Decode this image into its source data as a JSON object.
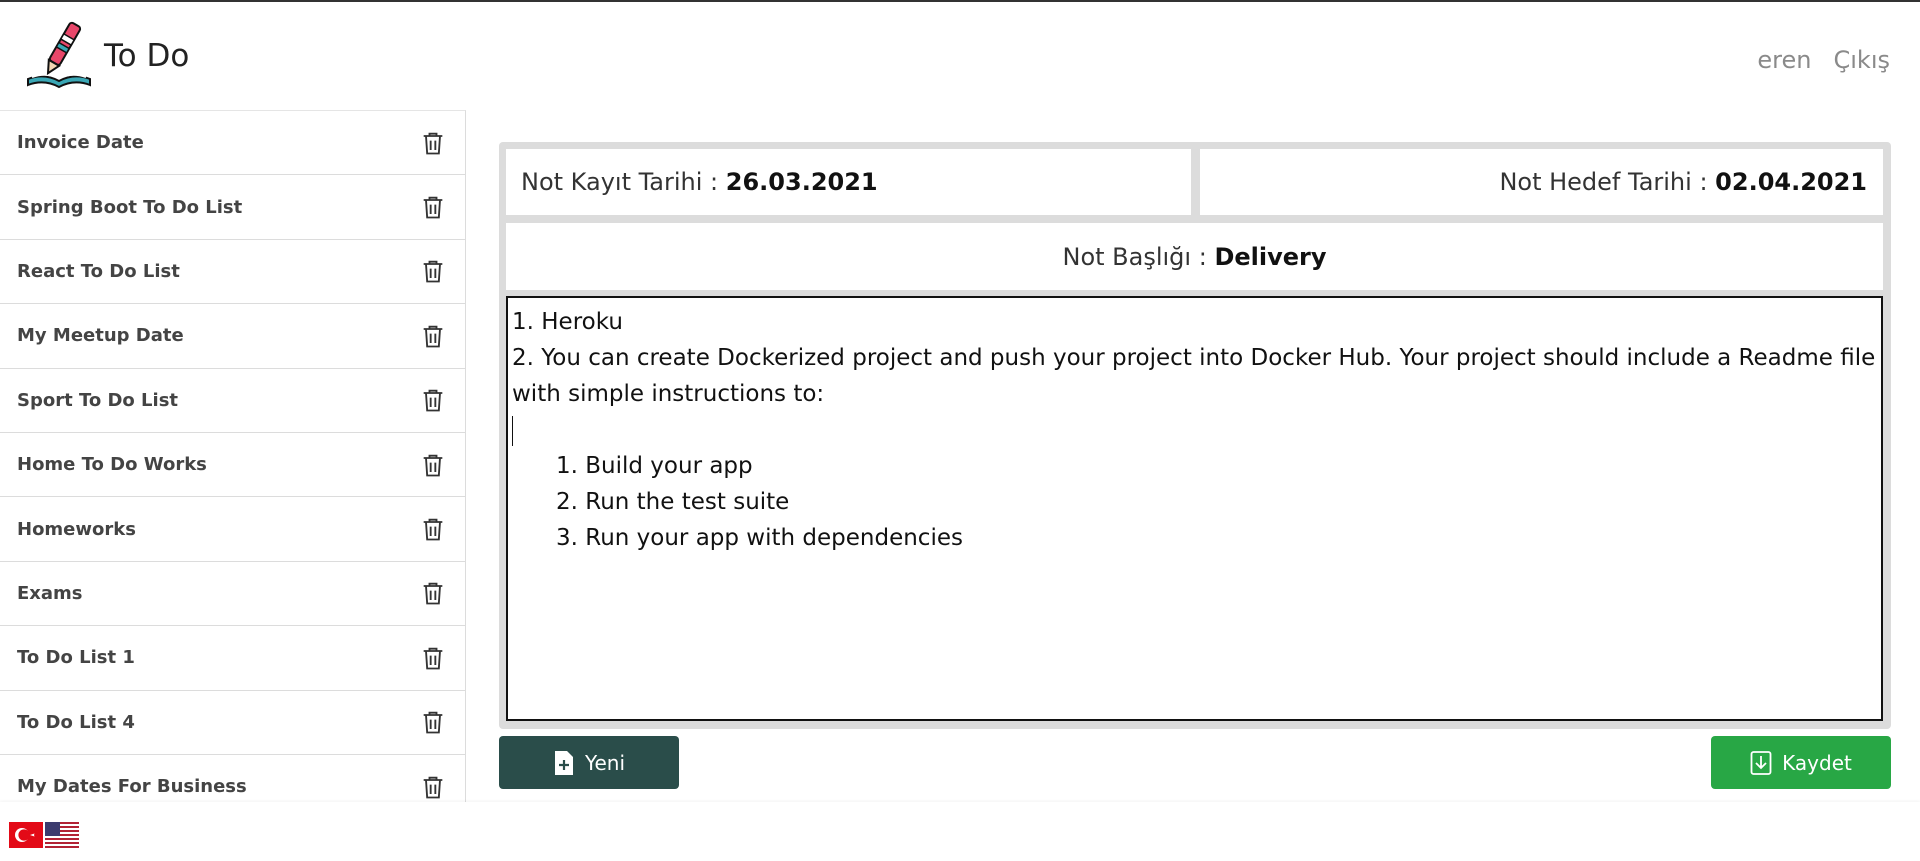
{
  "app": {
    "title": "To Do"
  },
  "nav": {
    "user": "eren",
    "logout": "Çıkış"
  },
  "sidebar": {
    "items": [
      {
        "label": "Invoice Date"
      },
      {
        "label": "Spring Boot To Do List"
      },
      {
        "label": "React To Do List"
      },
      {
        "label": "My Meetup Date"
      },
      {
        "label": "Sport To Do List"
      },
      {
        "label": "Home To Do Works"
      },
      {
        "label": "Homeworks"
      },
      {
        "label": "Exams"
      },
      {
        "label": "To Do List 1"
      },
      {
        "label": "To Do List 4"
      },
      {
        "label": "My Dates For Business"
      }
    ],
    "item_icon": "trash-icon"
  },
  "note": {
    "created_label": "Not Kayıt Tarihi :",
    "created_value": "26.03.2021",
    "target_label": "Not Hedef Tarihi :",
    "target_value": "02.04.2021",
    "title_label": "Not Başlığı :",
    "title_value": "Delivery",
    "content": {
      "line1": "1. Heroku",
      "line2": "2. You can create Dockerized project and push your project into Docker Hub. Your project should include a Readme file with simple instructions to:",
      "sub_items": [
        "1. Build your app",
        "2. Run the test suite",
        "3. Run your app with dependencies"
      ]
    }
  },
  "buttons": {
    "new_label": "Yeni",
    "save_label": "Kaydet"
  },
  "colors": {
    "new_button": "#2a4d4a",
    "save_button": "#28a745",
    "panel_bg": "#dcdcdc"
  },
  "footer": {
    "languages": [
      "tr-flag-icon",
      "us-flag-icon"
    ]
  }
}
